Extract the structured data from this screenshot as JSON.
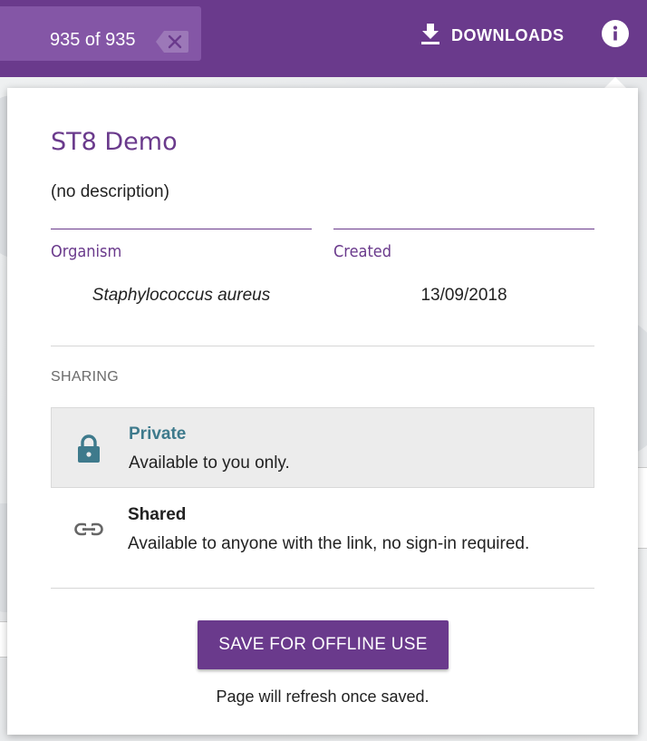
{
  "topbar": {
    "filter_count": "935 of 935",
    "downloads_label": "DOWNLOADS"
  },
  "card": {
    "title": "ST8 Demo",
    "description": "(no description)",
    "organism": {
      "label": "Organism",
      "value": "Staphylococcus aureus"
    },
    "created": {
      "label": "Created",
      "value": "13/09/2018"
    },
    "sharing": {
      "heading": "SHARING",
      "options": [
        {
          "title": "Private",
          "description": "Available to you only.",
          "icon": "lock-icon",
          "selected": true
        },
        {
          "title": "Shared",
          "description": "Available to anyone with the link, no sign-in required.",
          "icon": "link-icon",
          "selected": false
        }
      ]
    },
    "save_button": "SAVE FOR OFFLINE USE",
    "save_note": "Page will refresh once saved."
  },
  "colors": {
    "brand": "#6a3a8c",
    "private_accent": "#3e7a8c"
  }
}
